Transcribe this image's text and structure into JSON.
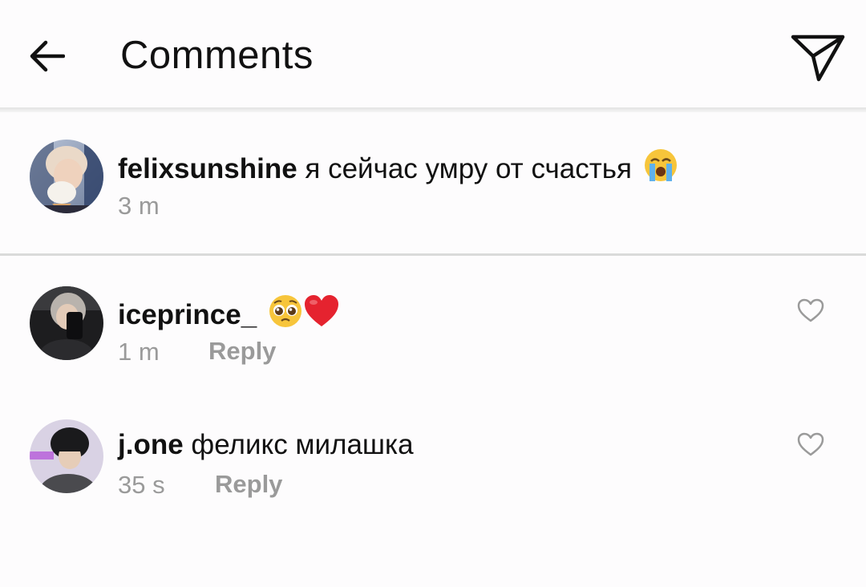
{
  "header": {
    "title": "Comments",
    "back_icon": "arrow-left-icon",
    "send_icon": "paper-plane-icon"
  },
  "caption": {
    "username": "felixsunshine",
    "text": "я сейчас умру от счастья",
    "emoji": "loudly-crying-face",
    "time": "3 m"
  },
  "comments": [
    {
      "username": "iceprince_",
      "text": "",
      "emojis": [
        "pleading-face",
        "red-heart"
      ],
      "time": "1 m",
      "reply_label": "Reply"
    },
    {
      "username": "j.one",
      "text": "феликс милашка",
      "time": "35 s",
      "reply_label": "Reply"
    }
  ],
  "colors": {
    "background": "#fdfcfd",
    "text": "#111111",
    "meta": "#9a9a9a",
    "divider": "#dadada"
  }
}
